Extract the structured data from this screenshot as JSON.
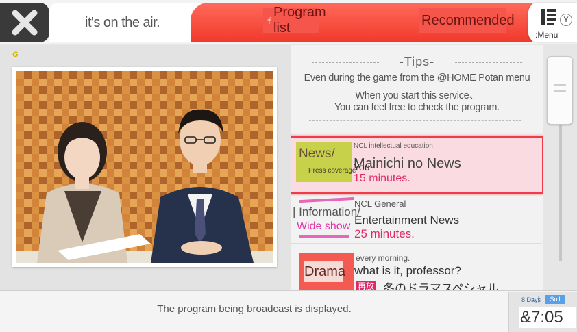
{
  "header": {
    "close_icon": "close-x-icon",
    "title": "it's on the air.",
    "tab_programs": "Program list",
    "tab_programs_marker": "ｆ",
    "tab_recommended": "Recommended",
    "menu_icon": "menu-book-icon",
    "menu_badge": "Y",
    "menu_label": ":Menu"
  },
  "player": {
    "badge": "G"
  },
  "tips": {
    "title": "-Tips-",
    "lines": [
      "Even during the game from the @HOME Potan menu",
      "When you start this service、",
      "You can feel free to check the program."
    ]
  },
  "programs": [
    {
      "genre": "News/",
      "subgenre": "Press coverage",
      "category": "NCL intellectual education",
      "title": "Mainichi no News",
      "subtitle": "You",
      "duration": "15 minutes.",
      "selected": true
    },
    {
      "genre": "| Information/",
      "subgenre": "Wide show",
      "category": "NCL General",
      "title": "Entertainment News",
      "duration": "25 minutes.",
      "selected": false
    },
    {
      "genre": "Drama",
      "category": "every morning.",
      "title": "what is it, professor?",
      "subtitle_tag": "再放",
      "subtitle": "冬のドラマスペシャル",
      "selected": false
    }
  ],
  "status": {
    "message": "The program being broadcast is displayed.",
    "days_label": "8 Days",
    "day_sep": "|",
    "day_badge": "Soil",
    "time": "&7:05"
  },
  "colors": {
    "accent_red": "#f0392c",
    "selection_border": "#f03c48",
    "duration_pink": "#e0296a",
    "genre_news": "#c7d24a",
    "genre_info": "#e667b9",
    "genre_drama": "#f25a52"
  }
}
